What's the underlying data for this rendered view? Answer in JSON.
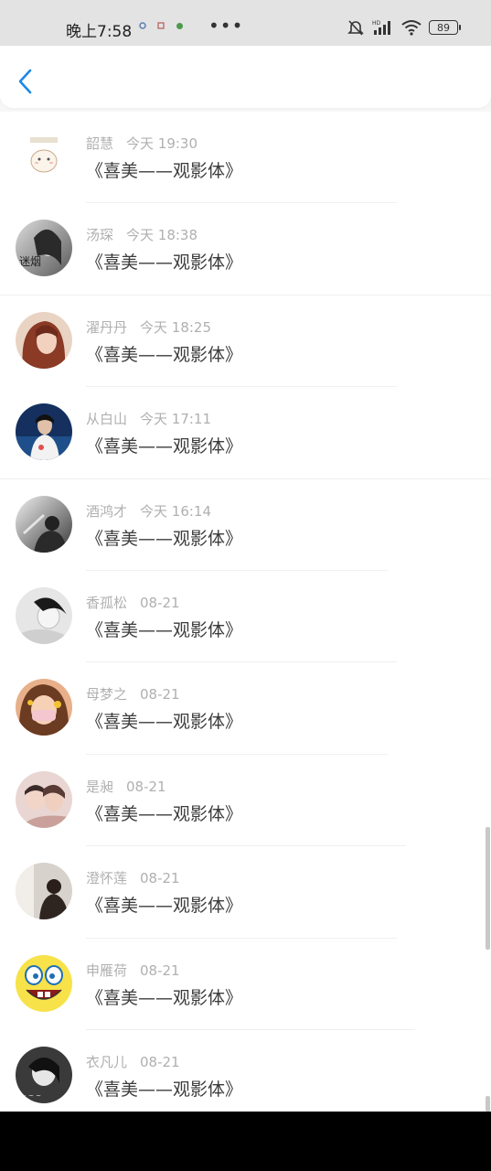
{
  "status_bar": {
    "time": "晚上7:58",
    "dots": "•••",
    "battery": "89"
  },
  "header": {
    "back_icon": "chevron-left-icon"
  },
  "accent_color": "#1e88e5",
  "list": {
    "items": [
      {
        "name": "韶慧",
        "time": "今天 19:30",
        "message": "《喜美——观影体》",
        "avatar_color": "#f5f0e6"
      },
      {
        "name": "汤琛",
        "time": "今天 18:38",
        "message": "《喜美——观影体》",
        "avatar_color": "#8a8a8a"
      },
      {
        "name": "濯丹丹",
        "time": "今天 18:25",
        "message": "《喜美——观影体》",
        "avatar_color": "#a0523a"
      },
      {
        "name": "从白山",
        "time": "今天 17:11",
        "message": "《喜美——观影体》",
        "avatar_color": "#1f3a6b"
      },
      {
        "name": "酒鸿才",
        "time": "今天 16:14",
        "message": "《喜美——观影体》",
        "avatar_color": "#6f6f6f"
      },
      {
        "name": "香孤松",
        "time": "08-21",
        "message": "《喜美——观影体》",
        "avatar_color": "#bdbdbd"
      },
      {
        "name": "母梦之",
        "time": "08-21",
        "message": "《喜美——观影体》",
        "avatar_color": "#d89a6b"
      },
      {
        "name": "是昶",
        "time": "08-21",
        "message": "《喜美——观影体》",
        "avatar_color": "#7a4c45"
      },
      {
        "name": "澄怀莲",
        "time": "08-21",
        "message": "《喜美——观影体》",
        "avatar_color": "#4a3a30"
      },
      {
        "name": "申雁荷",
        "time": "08-21",
        "message": "《喜美——观影体》",
        "avatar_color": "#f7e34a"
      },
      {
        "name": "衣凡儿",
        "time": "08-21",
        "message": "《喜美——观影体》",
        "avatar_color": "#505050"
      }
    ]
  }
}
